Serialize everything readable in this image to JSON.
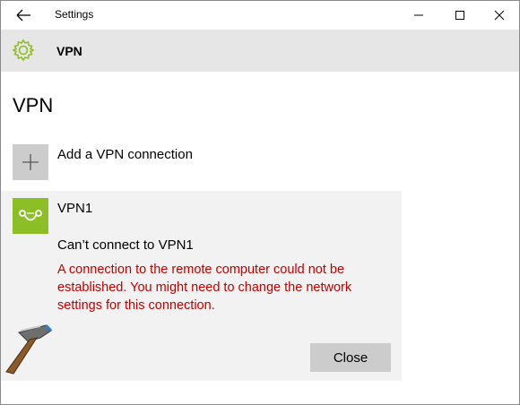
{
  "window": {
    "title": "Settings"
  },
  "header": {
    "title": "VPN"
  },
  "page": {
    "title": "VPN",
    "add_connection_label": "Add a VPN connection"
  },
  "vpn": {
    "name": "VPN1",
    "status": "Can’t connect to VPN1",
    "error_line1": "A connection to the remote computer could not be",
    "error_line2": "established.  You might need to change the network",
    "error_line3": "settings for this connection.",
    "close_label": "Close"
  },
  "colors": {
    "header_bg": "#e6e6e6",
    "accent_green": "#8cbf26",
    "error_red": "#c00000",
    "panel_bg": "#f2f2f2"
  },
  "icons": {
    "back": "back-arrow-icon",
    "header": "gear-icon",
    "add": "plus-icon",
    "vpn": "vpn-link-icon",
    "watermark": "hammer-logo-icon"
  }
}
